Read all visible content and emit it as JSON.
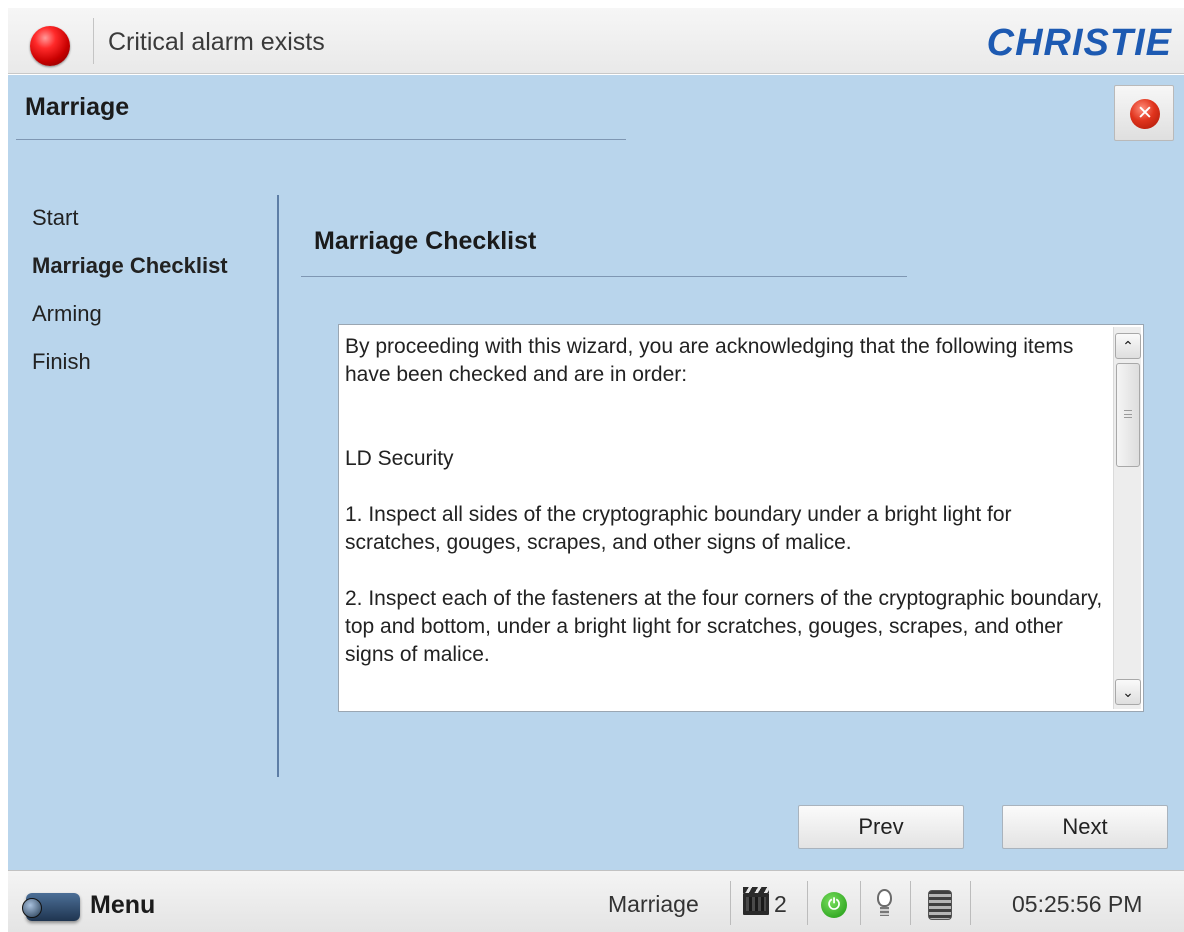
{
  "header": {
    "alarm_text": "Critical alarm exists",
    "brand": "CHRISTIE",
    "alarm_color": "#e00000",
    "brand_color": "#1d5ab2"
  },
  "page": {
    "title": "Marriage",
    "close_icon": "close-icon",
    "close_glyph": "✕"
  },
  "wizard": {
    "steps": [
      {
        "label": "Start"
      },
      {
        "label": "Marriage Checklist"
      },
      {
        "label": "Arming"
      },
      {
        "label": "Finish"
      }
    ],
    "current_step": "Marriage Checklist",
    "section_title": "Marriage Checklist",
    "checklist": {
      "intro": "By proceeding with this wizard, you are acknowledging that the following items have been checked and are in order:",
      "heading": "LD Security",
      "item1": "1. Inspect all sides of the cryptographic boundary under a bright light for scratches, gouges, scrapes, and other signs of malice.",
      "item2": "2. Inspect each of the fasteners at the four corners of the cryptographic boundary, top and bottom, under a bright light for scratches, gouges, scrapes, and other signs of malice."
    },
    "scroll_up_glyph": "⌃",
    "scroll_down_glyph": "⌄",
    "prev_label": "Prev",
    "next_label": "Next"
  },
  "taskbar": {
    "menu_label": "Menu",
    "mode": "Marriage",
    "clapper_count": "2",
    "power_glyph": "⏻",
    "time": "05:25:56 PM",
    "icons": [
      "projector-menu-icon",
      "clapperboard-icon",
      "power-icon",
      "lamp-bulb-icon",
      "dowser-icon"
    ]
  },
  "colors": {
    "panel_bg": "#b9d5ec",
    "divider": "#5d7ea6",
    "power_green": "#1c9711"
  }
}
